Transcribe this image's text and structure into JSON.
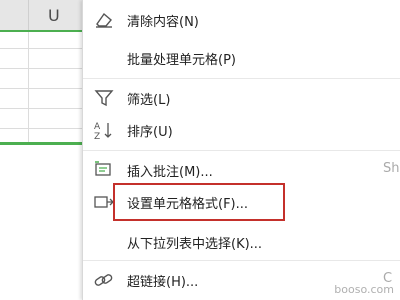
{
  "sheet": {
    "column_header": "U"
  },
  "menu": {
    "items": [
      {
        "label": "清除内容(N)",
        "icon": "eraser-icon"
      },
      {
        "label": "批量处理单元格(P)",
        "icon": ""
      },
      {
        "label": "筛选(L)",
        "icon": "funnel-filter-icon"
      },
      {
        "label": "排序(U)",
        "icon": "sort-az-icon"
      },
      {
        "label": "插入批注(M)...",
        "icon": "comment-icon",
        "shortcut": "Sh"
      },
      {
        "label": "设置单元格格式(F)...",
        "icon": "format-cells-icon",
        "highlighted": true
      },
      {
        "label": "从下拉列表中选择(K)...",
        "icon": ""
      },
      {
        "label": "超链接(H)...",
        "icon": "link-icon",
        "shortcut": "C"
      }
    ]
  },
  "watermark": "booso.com",
  "colors": {
    "accent_green": "#4caf50",
    "highlight_red": "#c4302b"
  }
}
